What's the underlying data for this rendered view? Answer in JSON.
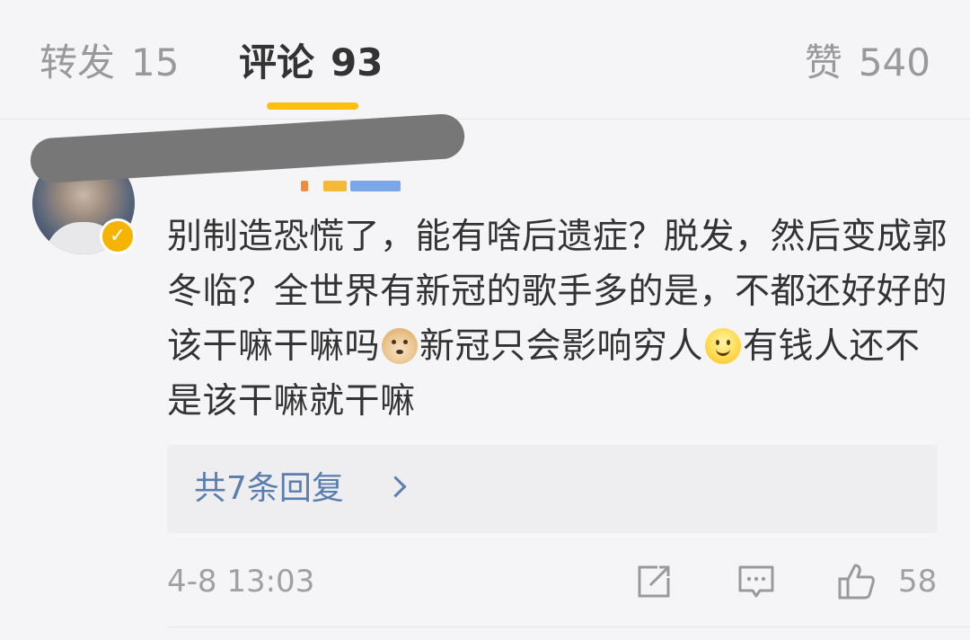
{
  "tabs": {
    "repost": {
      "label": "转发",
      "count": "15"
    },
    "comment": {
      "label": "评论",
      "count": "93"
    },
    "like": {
      "label": "赞",
      "count": "540"
    }
  },
  "comment": {
    "text_part1": "别制造恐慌了，能有啥后遗症？脱发，然后变成郭冬临？全世界有新冠的歌手多的是，不都还好好的该干嘛干嘛吗",
    "emoji1": "doge-emoji",
    "text_part2": "新冠只会影响穷人",
    "emoji2": "smile-emoji",
    "text_part3": "有钱人还不是该干嘛就干嘛",
    "replies_label": "共7条回复",
    "timestamp": "4-8 13:03",
    "like_count": "58"
  },
  "colors": {
    "accent_underline": "#ffbf10",
    "link_blue": "#5a7eb0",
    "verified_badge": "#f6b400"
  }
}
